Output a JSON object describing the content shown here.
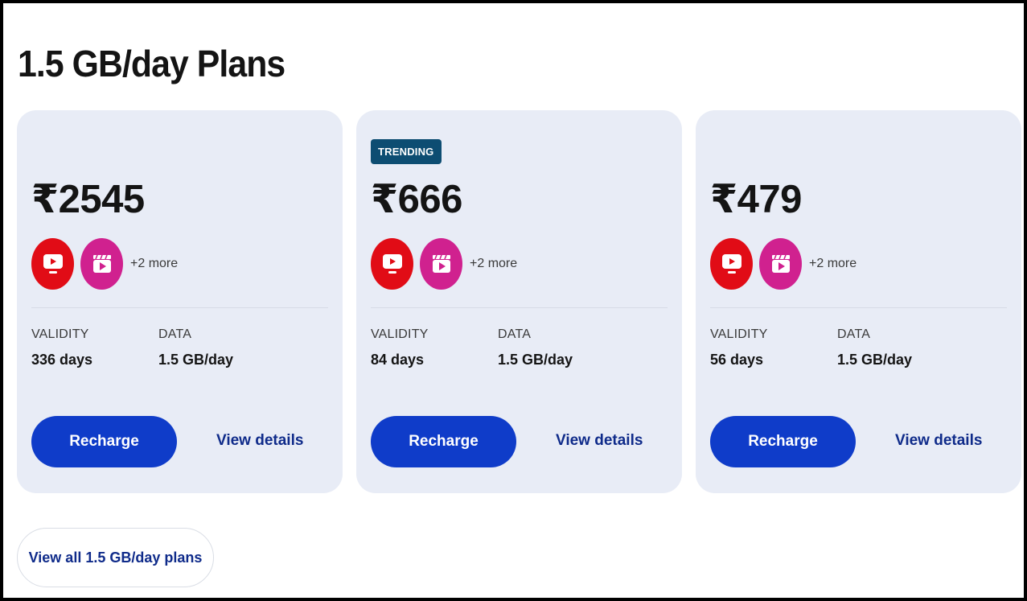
{
  "page": {
    "title": "1.5 GB/day Plans"
  },
  "plans": [
    {
      "badge": "",
      "price": "₹2545",
      "benefits": {
        "icons": [
          "tv-app-icon",
          "cinema-app-icon"
        ],
        "more": "+2 more"
      },
      "validity_label": "VALIDITY",
      "validity_value": "336 days",
      "data_label": "DATA",
      "data_value": "1.5 GB/day",
      "recharge_label": "Recharge",
      "details_label": "View details"
    },
    {
      "badge": "TRENDING",
      "price": "₹666",
      "benefits": {
        "icons": [
          "tv-app-icon",
          "cinema-app-icon"
        ],
        "more": "+2 more"
      },
      "validity_label": "VALIDITY",
      "validity_value": "84 days",
      "data_label": "DATA",
      "data_value": "1.5 GB/day",
      "recharge_label": "Recharge",
      "details_label": "View details"
    },
    {
      "badge": "",
      "price": "₹479",
      "benefits": {
        "icons": [
          "tv-app-icon",
          "cinema-app-icon"
        ],
        "more": "+2 more"
      },
      "validity_label": "VALIDITY",
      "validity_value": "56 days",
      "data_label": "DATA",
      "data_value": "1.5 GB/day",
      "recharge_label": "Recharge",
      "details_label": "View details"
    }
  ],
  "footer": {
    "view_all_label": "View all 1.5 GB/day plans"
  },
  "colors": {
    "card_bg": "#e8ecf6",
    "primary": "#0f3cc9",
    "link": "#0f2b8a",
    "badge": "#0d4d72",
    "tv_icon": "#e10c16",
    "cinema_icon": "#d0218f"
  }
}
